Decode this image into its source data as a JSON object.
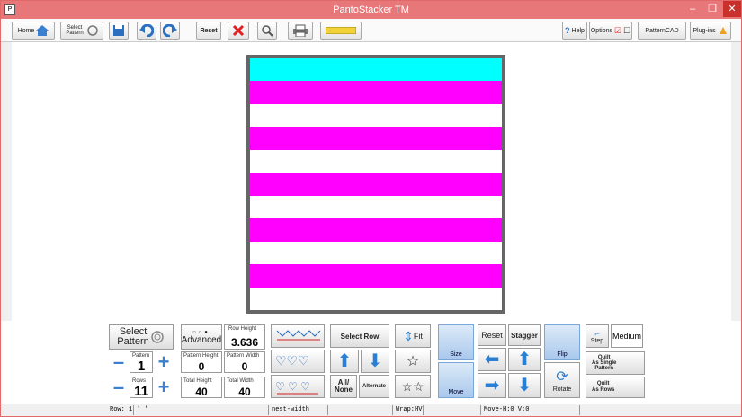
{
  "window": {
    "title": "PantoStacker TM",
    "app_icon": "P",
    "minimize": "–",
    "restore": "❐",
    "close": "✕"
  },
  "toolbar": {
    "home": "Home",
    "select_pattern": "Select Pattern",
    "reset": "Reset",
    "help": "Help",
    "options": "Options",
    "patterncad": "PatternCAD",
    "plugins": "Plug-ins"
  },
  "colors": {
    "cyan": "#00ffff",
    "magenta": "#ff00ff",
    "title": "#e8777a"
  },
  "quilt_rows": [
    {
      "color": "cyan"
    },
    {
      "color": "magenta"
    },
    {
      "color": "white"
    },
    {
      "color": "magenta"
    },
    {
      "color": "white"
    },
    {
      "color": "magenta"
    },
    {
      "color": "white"
    },
    {
      "color": "magenta"
    },
    {
      "color": "white"
    },
    {
      "color": "magenta"
    },
    {
      "color": "white"
    }
  ],
  "panel": {
    "select_pattern": "Select\nPattern",
    "pattern_label": "Pattern",
    "pattern_value": "1",
    "rows_label": "Rows",
    "rows_value": "11",
    "advanced": "Advanced",
    "row_height_label": "Row Height",
    "row_height_value": "3.636",
    "pattern_height_label": "Pattern Height",
    "pattern_height_value": "0",
    "pattern_width_label": "Pattern Width",
    "pattern_width_value": "0",
    "total_height_label": "Total Height",
    "total_height_value": "40",
    "total_width_label": "Total Width",
    "total_width_value": "40",
    "select_row": "Select Row",
    "all_none": "All/\nNone",
    "alternate": "Alternate",
    "fit": "Fit",
    "size": "Size",
    "move": "Move",
    "reset": "Reset",
    "stagger": "Stagger",
    "flip": "Flip",
    "rotate": "Rotate",
    "step": "Step",
    "step_value": "Medium",
    "quilt_single": "Quilt\nAs Single\nPattern",
    "quilt_rows": "Quilt\nAs Rows"
  },
  "status": {
    "row": "Row: 1",
    "field2": "' '",
    "nest": "nest-width",
    "wrap": "Wrap:HV",
    "move": "Move-H:0 V:0"
  }
}
